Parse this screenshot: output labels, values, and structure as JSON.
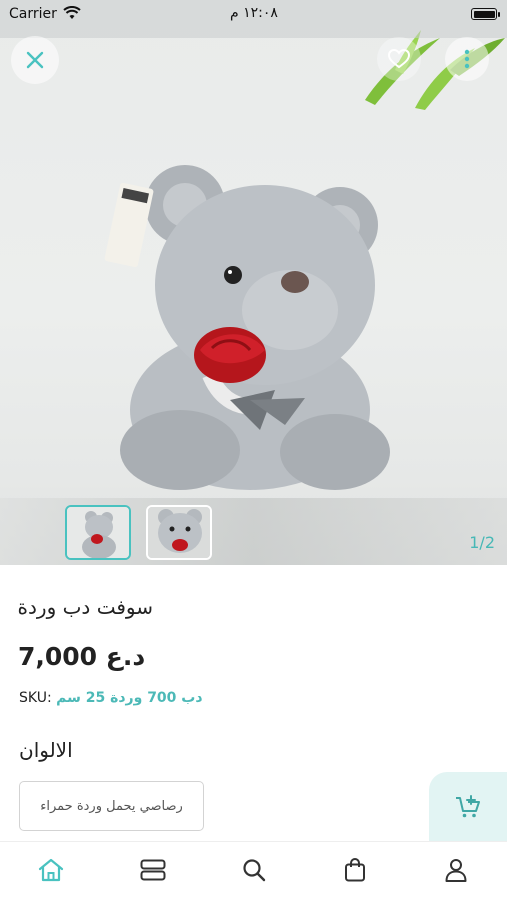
{
  "status_bar": {
    "carrier": "Carrier",
    "time": "١٢:٠٨ م"
  },
  "gallery": {
    "counter": "1/2"
  },
  "product": {
    "title": "سوفت دب وردة",
    "price": "7,000 د.ع",
    "sku_label": "SKU:",
    "sku_value": "دب 700 وردة 25 سم"
  },
  "colors": {
    "label": "الالوان",
    "selected_option": "رصاصي يحمل وردة حمراء"
  },
  "icons": {
    "close": "close-icon",
    "favorite": "heart-icon",
    "more": "more-vertical-icon",
    "add_to_cart": "cart-plus-icon",
    "tabs": [
      "home-icon",
      "categories-icon",
      "search-icon",
      "bag-icon",
      "profile-icon"
    ]
  },
  "colors_theme": {
    "accent": "#49c2c0",
    "accent_light": "#e2f4f3"
  }
}
